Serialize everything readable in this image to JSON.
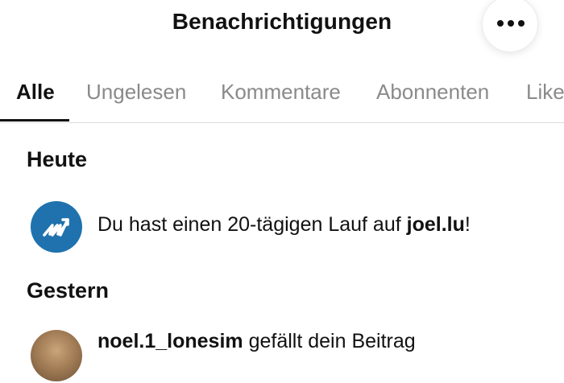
{
  "header": {
    "title": "Benachrichtigungen",
    "more_icon": "more-horizontal-icon"
  },
  "tabs": [
    {
      "label": "Alle",
      "active": true
    },
    {
      "label": "Ungelesen",
      "active": false
    },
    {
      "label": "Kommentare",
      "active": false
    },
    {
      "label": "Abonnenten",
      "active": false
    },
    {
      "label": "Likes",
      "active": false
    }
  ],
  "sections": [
    {
      "heading": "Heute",
      "items": [
        {
          "icon": "streak-trend-icon",
          "icon_color": "#1f72ad",
          "text_before": "Du hast einen 20-tägigen Lauf auf ",
          "text_bold": "joel.lu",
          "text_after": "!"
        }
      ]
    },
    {
      "heading": "Gestern",
      "items": [
        {
          "avatar": "user-avatar",
          "username": "noel.1_lonesim",
          "text": " gefällt dein Beitrag"
        }
      ]
    }
  ],
  "colors": {
    "active_tab": "#111111",
    "inactive_tab": "#8a8a8a",
    "divider": "#dcdcdc",
    "accent": "#1f72ad"
  }
}
